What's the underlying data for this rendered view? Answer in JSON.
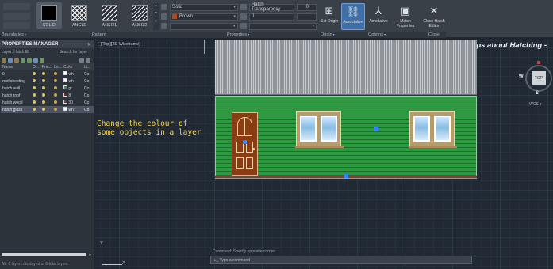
{
  "ribbon": {
    "patterns": [
      {
        "label": "SOLID",
        "swatch": "solid",
        "active": true
      },
      {
        "label": "ANGLE",
        "swatch": "angle",
        "active": false
      },
      {
        "label": "ANSI31",
        "swatch": "ansi31",
        "active": false
      },
      {
        "label": "ANSI32",
        "swatch": "ansi32",
        "active": false
      }
    ],
    "props": {
      "row1_field": "Solid",
      "row1_field2": "Hatch Transparency",
      "row1_value": "0",
      "row2_field": "Brown",
      "row2_field2": "0",
      "row3_value": ""
    },
    "buttons": {
      "set_origin": "Set Origin",
      "associative": "Associative",
      "annotative": "Annotative",
      "match_props": "Match Properties",
      "close_hatch": "Close Hatch Editor"
    },
    "panel_titles": {
      "boundaries": "Boundaries",
      "pattern": "Pattern",
      "properties": "Properties",
      "origin": "Origin",
      "options": "Options",
      "close": "Close"
    }
  },
  "properties_manager": {
    "title": "PROPERTIES MANAGER",
    "close": "✕",
    "current_layer": "Layer: Hatch fill",
    "search_label": "Search for layer",
    "columns": [
      "Name",
      "O...",
      "Fre...",
      "Lo...",
      "Color",
      "Li..."
    ],
    "rows": [
      {
        "name": "0",
        "color": "wh",
        "line": "Co",
        "selected": false
      },
      {
        "name": "roof sheeting",
        "color": "wh",
        "line": "Co",
        "selected": false
      },
      {
        "name": "hatch wall",
        "color": "gr",
        "line": "Co",
        "selected": false
      },
      {
        "name": "hatch roof",
        "color": "8",
        "line": "Co",
        "selected": false
      },
      {
        "name": "hatch wood",
        "color": "30",
        "line": "Co",
        "selected": false
      },
      {
        "name": "hatch glass",
        "color": "wh",
        "line": "Co",
        "selected": false
      }
    ],
    "status": "All: 6 layers displayed of 6 total layers"
  },
  "canvas": {
    "viewport_label": "[-][Top][2D Wireframe]",
    "tips_title": "Fast tips about Hatching -",
    "annotation": "Change the colour of\nsome objects in a layer",
    "navcube": {
      "top": "TOP",
      "west": "W",
      "south": "S",
      "wcs": "WCS ▾"
    },
    "ucs": {
      "x": "X",
      "y": "Y"
    },
    "command_history": "Command: Specify opposite corner:",
    "command_prompt": "▸_ Type a command"
  },
  "colors": {
    "wall_green": "#2c9a3f",
    "door_brown": "#8b3d12",
    "grip_blue": "#2f86ff",
    "annotation_yellow": "#f2d44a",
    "brown_swatch": "#b5481a"
  }
}
